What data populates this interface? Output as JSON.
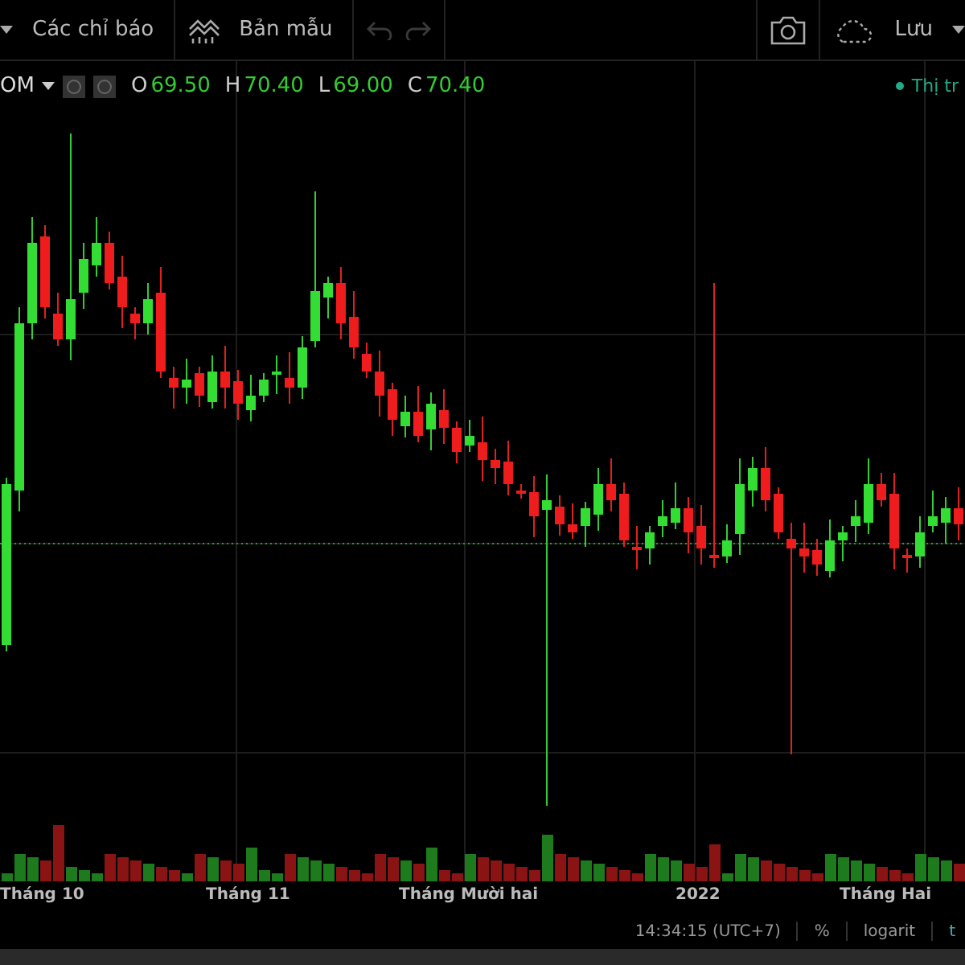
{
  "toolbar": {
    "indicators_label": "Các chỉ báo",
    "templates_label": "Bản mẫu",
    "save_label": "Lưu",
    "undo_disabled": true,
    "redo_disabled": true
  },
  "legend": {
    "symbol": "OM",
    "values": [
      {
        "key": "O",
        "value": "69.50"
      },
      {
        "key": "H",
        "value": "70.40"
      },
      {
        "key": "L",
        "value": "69.00"
      },
      {
        "key": "C",
        "value": "70.40"
      }
    ],
    "market_status": "Thị tr"
  },
  "time_axis": [
    "Tháng 10",
    "Tháng 11",
    "Tháng Mười hai",
    "2022",
    "Tháng Hai"
  ],
  "status_bar": {
    "time": "14:34:15 (UTC+7)",
    "percent": "%",
    "log": "logarit",
    "auto": "t"
  }
}
